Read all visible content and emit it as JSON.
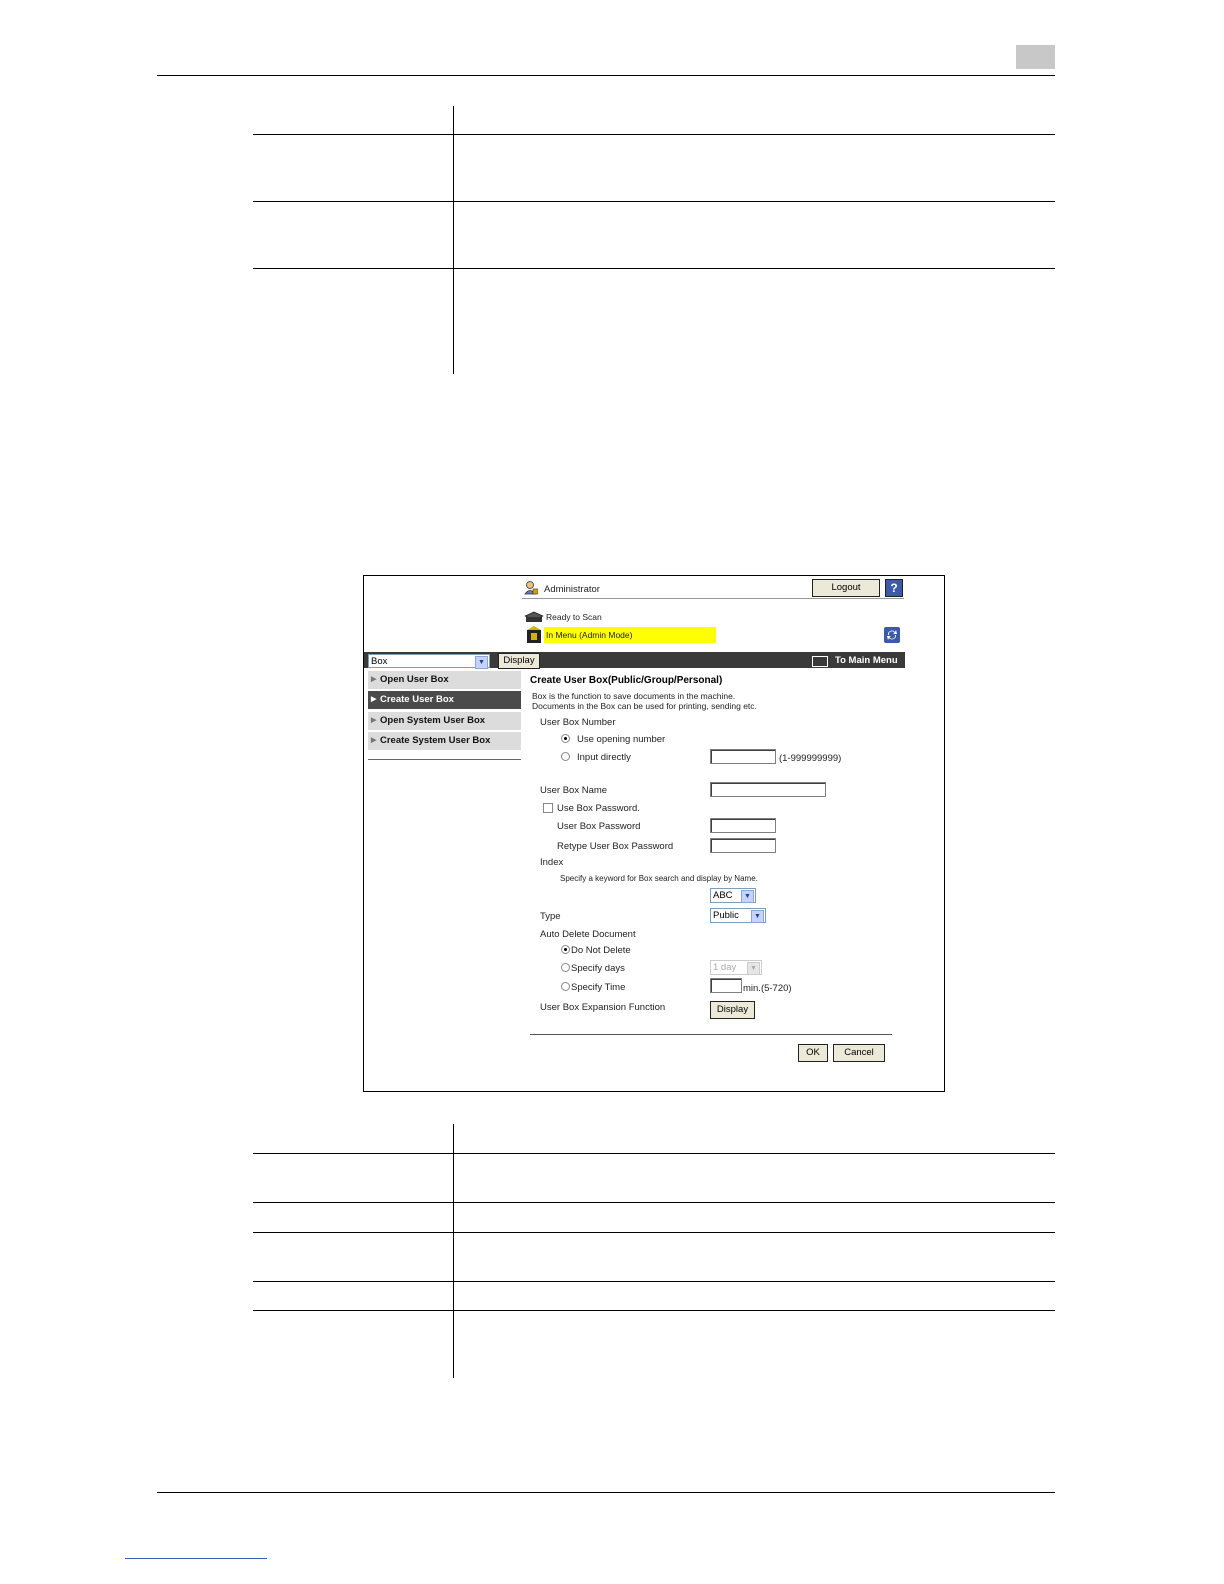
{
  "header": {
    "page_tab": ""
  },
  "screenshot": {
    "admin_label": "Administrator",
    "logout_label": "Logout",
    "help_icon": "question-mark-icon",
    "status_ready": "Ready to Scan",
    "status_mode": "In Menu (Admin Mode)",
    "refresh_icon": "refresh-icon",
    "category_select": "Box",
    "display_button": "Display",
    "to_main_menu": "To Main Menu",
    "nav": [
      {
        "label": "Open User Box",
        "active": false
      },
      {
        "label": "Create User Box",
        "active": true
      },
      {
        "label": "Open System User Box",
        "active": false
      },
      {
        "label": "Create System User Box",
        "active": false
      }
    ],
    "form": {
      "title": "Create User Box(Public/Group/Personal)",
      "desc1": "Box is the function to save documents in the machine.",
      "desc2": "Documents in the Box can be used for printing, sending etc.",
      "number_label": "User Box Number",
      "use_opening": "Use opening number",
      "input_directly": "Input directly",
      "number_range": "(1-999999999)",
      "name_label": "User Box Name",
      "use_password": "Use Box Password.",
      "password_label": "User Box Password",
      "retype_label": "Retype User Box Password",
      "index_label": "Index",
      "index_hint": "Specify a keyword for Box search and display by Name.",
      "index_value": "ABC",
      "type_label": "Type",
      "type_value": "Public",
      "auto_delete_label": "Auto Delete Document",
      "do_not_delete": "Do Not Delete",
      "specify_days": "Specify days",
      "days_value": "1 day",
      "specify_time": "Specify Time",
      "time_unit": "min.(5-720)",
      "expansion_label": "User Box Expansion Function",
      "expansion_button": "Display",
      "ok_button": "OK",
      "cancel_button": "Cancel"
    }
  }
}
